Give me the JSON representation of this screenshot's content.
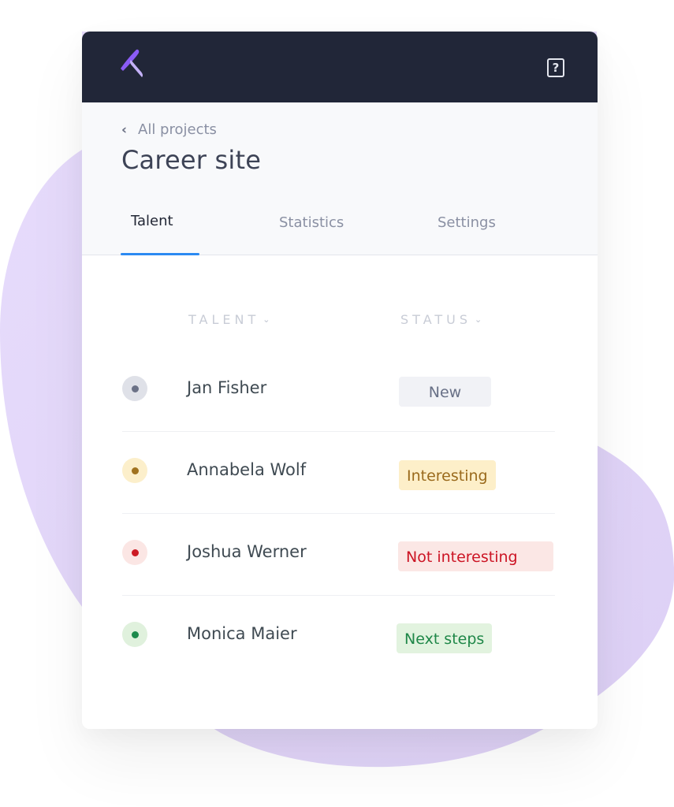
{
  "header_bar": {
    "logo_icon": "brand-logo",
    "help_icon": "help-square-icon",
    "help_label": "?"
  },
  "breadcrumb": {
    "icon": "chevron-left-icon",
    "back_label": "All projects"
  },
  "page_title": "Career site",
  "tabs": [
    {
      "label": "Talent",
      "active": true
    },
    {
      "label": "Statistics",
      "active": false
    },
    {
      "label": "Settings",
      "active": false
    }
  ],
  "table": {
    "columns": [
      {
        "label": "TALENT",
        "sort_icon": "chevron-down-icon"
      },
      {
        "label": "STATUS",
        "sort_icon": "chevron-down-icon"
      }
    ],
    "rows": [
      {
        "name": "Jan Fisher",
        "status": "New"
      },
      {
        "name": "Annabela Wolf",
        "status": "Interesting"
      },
      {
        "name": "Joshua Werner",
        "status": "Not interesting"
      },
      {
        "name": "Monica Maier",
        "status": "Next steps"
      }
    ]
  },
  "colors": {
    "topbar": "#212638",
    "accent_tab": "#2b8af2",
    "brand_purple": "#8b5cf6",
    "blob": "#e6dbfb",
    "status_new": {
      "bg": "#f1f2f6",
      "fg": "#687086",
      "dot": "#6b7186",
      "dot_bg": "#dfe1e8"
    },
    "status_interesting": {
      "bg": "#fdefc9",
      "fg": "#9a6a1c",
      "dot": "#a0721f",
      "dot_bg": "#fcefcb"
    },
    "status_not_interesting": {
      "bg": "#fbe7e5",
      "fg": "#cc1424",
      "dot": "#cc1a24",
      "dot_bg": "#fbe6e4"
    },
    "status_next_steps": {
      "bg": "#e2f3df",
      "fg": "#1f8748",
      "dot": "#1d8a4c",
      "dot_bg": "#e0f1dd"
    }
  }
}
